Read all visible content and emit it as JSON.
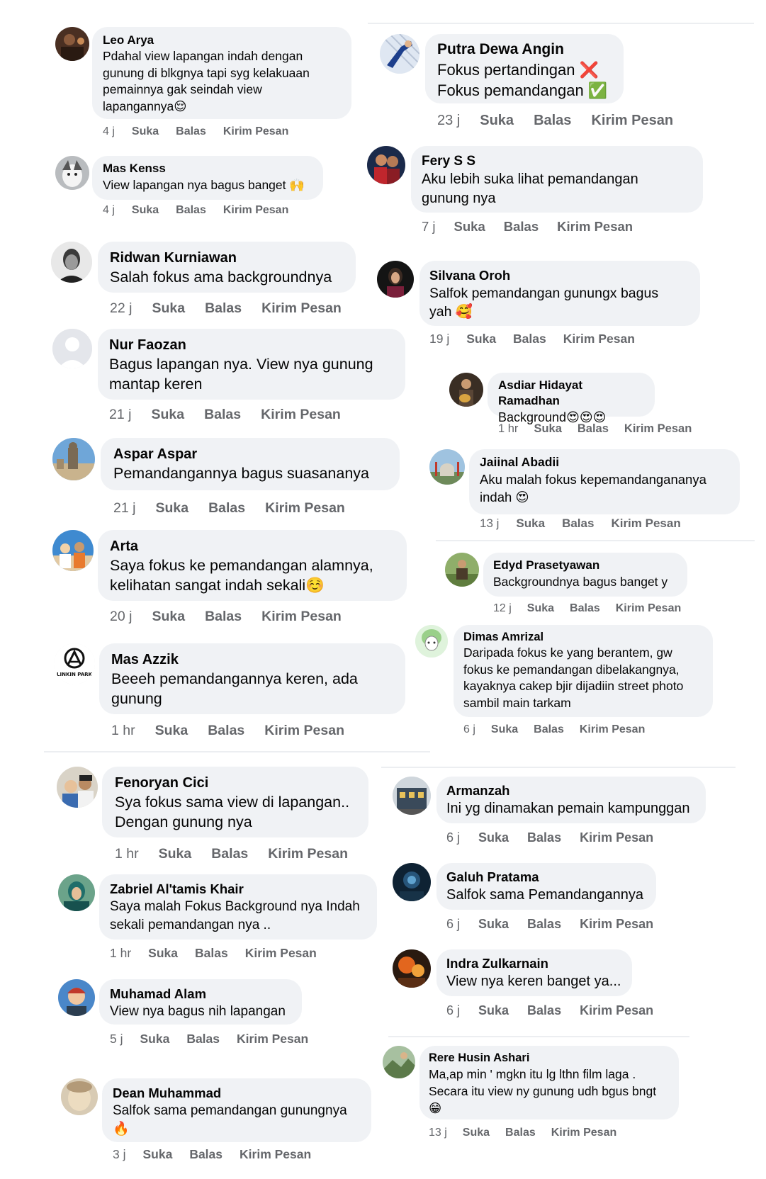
{
  "actions": {
    "like": "Suka",
    "reply": "Balas",
    "message": "Kirim Pesan"
  },
  "colors": {
    "bubble": "#f0f2f5",
    "meta": "#65676b",
    "text": "#050505",
    "cross": "#e53935",
    "check": "#43a047"
  },
  "comments": [
    {
      "name": "Leo Arya",
      "text": "Pdahal view lapangan indah dengan\ngunung di blkgnya tapi syg kelakuaan\npemainnya gak seindah view\nlapangannya😌",
      "time": "4 j",
      "avatar": "dark-crowd-avatar"
    },
    {
      "name": "Mas Kenss",
      "text": "View lapangan nya bagus banget 🙌",
      "time": "4 j",
      "avatar": "husky-dog-avatar"
    },
    {
      "name": "Ridwan Kurniawan",
      "text": "Salah fokus ama backgroundnya",
      "time": "22 j",
      "avatar": "bw-portrait-avatar"
    },
    {
      "name": "Nur Faozan",
      "text": "Bagus lapangan nya. View nya gunung\nmantap keren",
      "time": "21 j",
      "avatar": "default-person-avatar"
    },
    {
      "name": "Aspar Aspar",
      "text": "Pemandangannya bagus suasananya",
      "time": "21 j",
      "avatar": "statue-sky-avatar"
    },
    {
      "name": "Arta",
      "text": "Saya fokus ke pemandangan alamnya,\nkelihatan sangat indah sekali☺️",
      "time": "20 j",
      "avatar": "group-photo-avatar"
    },
    {
      "name": "Mas Azzik",
      "text": "Beeeh pemandangannya keren, ada\ngunung",
      "time": "1 hr",
      "avatar": "linkin-park-logo-avatar",
      "logo_text": "LINKIN PARK"
    },
    {
      "name": "Fenoryan Cici",
      "text": "Sya fokus sama view di lapangan..\nDengan gunung nya",
      "time": "1 hr",
      "avatar": "couple-selfie-avatar"
    },
    {
      "name": "Zabriel Al'tamis Khair",
      "text": "Saya malah Fokus Background nya Indah\nsekali pemandangan nya ..",
      "time": "1 hr",
      "avatar": "teal-hijab-avatar"
    },
    {
      "name": "Muhamad Alam",
      "text": "View nya bagus nih lapangan",
      "time": "5 j",
      "avatar": "cartoon-boy-avatar"
    },
    {
      "name": "Dean Muhammad",
      "text": "Salfok sama pemandangan gunungnya\n🔥",
      "time": "3 j",
      "avatar": "blurred-face-avatar"
    },
    {
      "name": "Putra Dewa Angin",
      "text": "Fokus pertandingan ❌\nFokus pemandangan ✅",
      "time": "23 j",
      "avatar": "goalkeeper-avatar"
    },
    {
      "name": "Fery S S",
      "text": "Aku lebih suka lihat pemandangan\ngunung nya",
      "time": "7 j",
      "avatar": "red-jersey-avatar"
    },
    {
      "name": "Silvana Oroh",
      "text": "Salfok pemandangan gunungx bagus\nyah 🥰",
      "time": "19 j",
      "avatar": "night-portrait-avatar"
    },
    {
      "name": "Asdiar Hidayat Ramadhan",
      "text": "Background😍😍😍",
      "time": "1 hr",
      "avatar": "guitar-player-avatar"
    },
    {
      "name": "Jaiinal Abadii",
      "text": "Aku malah fokus kepemandangananya\nindah 😍",
      "time": "13 j",
      "avatar": "mosque-avatar"
    },
    {
      "name": "Edyd Prasetyawan",
      "text": "Backgroundnya bagus banget y",
      "time": "12 j",
      "avatar": "field-rider-avatar"
    },
    {
      "name": "Dimas Amrizal",
      "text": "Daripada fokus ke yang berantem, gw\nfokus ke pemandangan dibelakangnya,\nkayaknya cakep bjir dijadiin street photo\nsambil main tarkam",
      "time": "6 j",
      "avatar": "anime-girl-avatar"
    },
    {
      "name": "Armanzah",
      "text": "Ini yg dinamakan pemain kampunggan",
      "time": "6 j",
      "avatar": "building-street-avatar"
    },
    {
      "name": "Galuh Pratama",
      "text": "Salfok sama Pemandangannya",
      "time": "6 j",
      "avatar": "dark-blue-avatar"
    },
    {
      "name": "Indra Zulkarnain",
      "text": "View nya keren banget ya...",
      "time": "6 j",
      "avatar": "orange-night-avatar"
    },
    {
      "name": "Rere Husin Ashari",
      "text": "Ma,ap min ' mgkn itu lg lthn film laga .\nSecara itu view ny gunung udh bgus bngt\n😁",
      "time": "13 j",
      "avatar": "landscape-person-avatar"
    }
  ]
}
